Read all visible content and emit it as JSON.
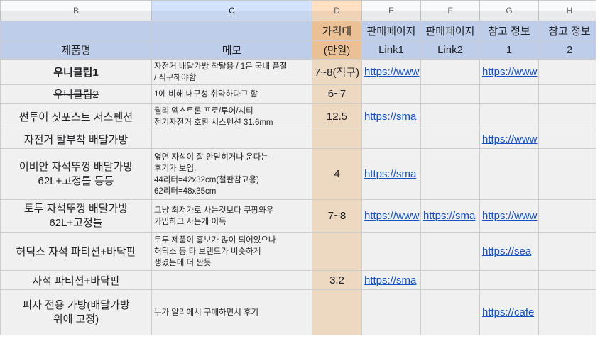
{
  "columns": [
    "B",
    "C",
    "D",
    "E",
    "F",
    "G",
    "H"
  ],
  "header": {
    "row1": {
      "B": "",
      "C": "",
      "D": "가격대",
      "E": "판매페이지",
      "F": "판매페이지",
      "G": "참고 정보",
      "H": "참고 정보"
    },
    "row2": {
      "B": "제품명",
      "C": "메모",
      "D": "(만원)",
      "E": "Link1",
      "F": "Link2",
      "G": "1",
      "H": "2"
    }
  },
  "rows": [
    {
      "name": "우니클립1",
      "memo": [
        "자전거 배달가방 착탈용 / 1은 국내 품절",
        "/ 직구해야함"
      ],
      "price": "7~8(직구)",
      "link1": "https://www",
      "link2": "",
      "ref1": "https://www",
      "ref2": ""
    },
    {
      "name": "우니클립2",
      "memo": [
        "1에 비해 내구성 취약하다고 함"
      ],
      "price": "6~7",
      "link1": "",
      "link2": "",
      "ref1": "",
      "ref2": ""
    },
    {
      "name": "썬투어 싯포스트 서스펜션",
      "memo": [
        "퀄리 엑스트론 프로/투어/시티",
        "전기자전거 호환 서스펜션 31.6mm"
      ],
      "price": "12.5",
      "link1": "https://sma",
      "link2": "",
      "ref1": "",
      "ref2": ""
    },
    {
      "name": "자전거 탈부착 배달가방",
      "memo": [],
      "price": "",
      "link1": "",
      "link2": "",
      "ref1": "https://www",
      "ref2": ""
    },
    {
      "name1": "이비안 자석뚜껑 배달가방",
      "name2": "62L+고정틀 등등",
      "memo": [
        "옆면 자석이 잘 안닫히거나 운다는",
        "후기가 보임.",
        "44리터=42x32cm(철판참고용)",
        "62리터=48x35cm"
      ],
      "price": "4",
      "link1": "https://sma",
      "link2": "",
      "ref1": "",
      "ref2": ""
    },
    {
      "name1": "토투 자석뚜껑 배달가방",
      "name2": "62L+고정틀",
      "memo": [
        "그냥 최저가로 사는것보다 쿠팡와우",
        "가입하고 사는게 이득"
      ],
      "price": "7~8",
      "link1": "https://www",
      "link2": "https://sma",
      "ref1": "https://www",
      "ref2": ""
    },
    {
      "name": "허딕스 자석 파티션+바닥판",
      "memo": [
        "토투 제품이 홍보가 많이 되어있으나",
        "허딕스 등 타 브랜드가 비슷하게",
        "생겼는데 더 싼듯"
      ],
      "price": "",
      "link1": "",
      "link2": "",
      "ref1": "https://sea",
      "ref2": ""
    },
    {
      "name": "자석 파티션+바닥판",
      "memo": [],
      "price": "3.2",
      "link1": "https://sma",
      "link2": "",
      "ref1": "",
      "ref2": ""
    },
    {
      "name1": "피자 전용 가방(배달가방",
      "name2": "위에 고정)",
      "memo": [
        "누가 알리에서 구매하면서 후기"
      ],
      "price": "",
      "link1": "",
      "link2": "",
      "ref1": "https://cafe",
      "ref2": ""
    }
  ]
}
